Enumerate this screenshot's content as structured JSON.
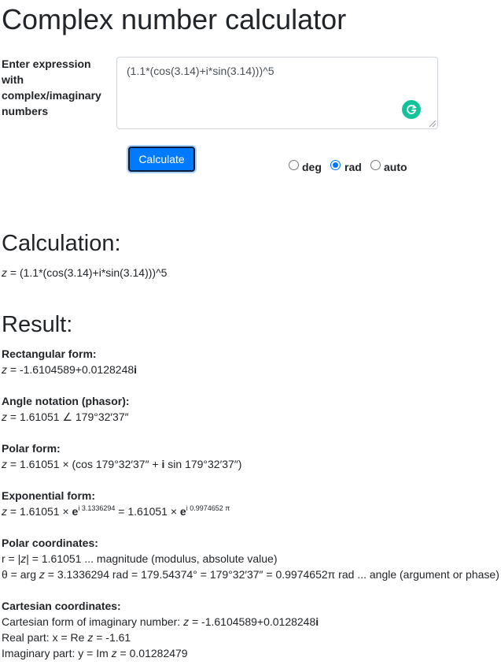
{
  "page_title": "Complex number calculator",
  "input": {
    "label": "Enter expression with complex/imaginary numbers",
    "value": "(1.1*(cos(3.14)+i*sin(3.14)))^5"
  },
  "calculate_label": "Calculate",
  "angle_modes": [
    {
      "label": "deg",
      "checked": false
    },
    {
      "label": "rad",
      "checked": true
    },
    {
      "label": "auto",
      "checked": false
    }
  ],
  "calculation": {
    "heading": "Calculation:",
    "var": "z",
    "eq": " = (1.1*(cos(3.14)+i*sin(3.14)))^5"
  },
  "result": {
    "heading": "Result:",
    "rectangular": {
      "title": "Rectangular form:",
      "var": "z",
      "value": " = -1.6104589+0.0128248",
      "i": "i"
    },
    "phasor": {
      "title": "Angle notation (phasor):",
      "var": "z",
      "value": " = 1.61051 ∠ 179°32′37″"
    },
    "polar": {
      "title": "Polar form:",
      "var": "z",
      "pre": " = 1.61051 × (cos 179°32′37″ + ",
      "i": "i",
      "post": " sin 179°32′37″)"
    },
    "exponential": {
      "title": "Exponential form:",
      "var": "z",
      "pre": " = 1.61051 × ",
      "e1": "e",
      "sup1": "i 3.1336294",
      "mid": " = 1.61051 × ",
      "e2": "e",
      "sup2": "i 0.9974652 π"
    },
    "polar_coordinates": {
      "title": "Polar coordinates:",
      "r_pre": "r = |",
      "r_var": "z",
      "r_post": "| = 1.61051 ... magnitude (modulus, absolute value)",
      "theta_pre": "θ = arg ",
      "theta_var": "z",
      "theta_post": " = 3.1336294 rad = 179.54374° = 179°32′37″ = 0.9974652π rad ... angle (argument or phase)"
    },
    "cartesian": {
      "title": "Cartesian coordinates:",
      "form_pre": "Cartesian form of imaginary number: ",
      "form_var": "z",
      "form_value": " = -1.6104589+0.0128248",
      "form_i": "i",
      "real_pre": "Real part: x = Re ",
      "real_var": "z",
      "real_post": " = -1.61",
      "imag_pre": "Imaginary part: y = Im ",
      "imag_var": "z",
      "imag_post": " = 0.01282479"
    }
  }
}
